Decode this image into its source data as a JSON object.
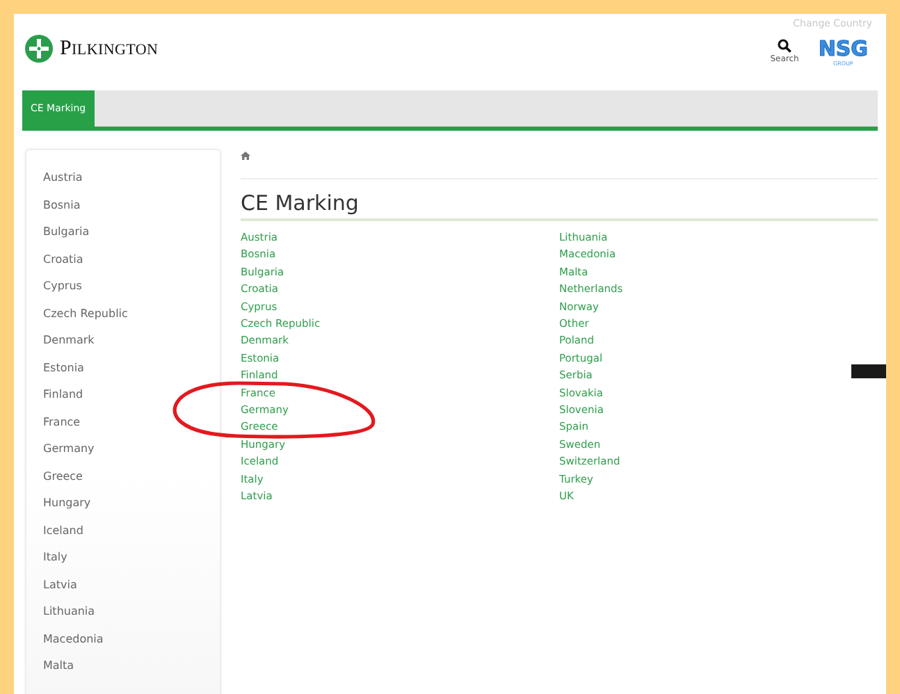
{
  "header": {
    "change_country": "Change Country",
    "logo_text": "Pilkington",
    "search_label": "Search",
    "group_logo": "NSG",
    "group_sub": "GROUP"
  },
  "nav_tabs": [
    {
      "label": "CE Marking",
      "selected": true
    }
  ],
  "sidebar": {
    "items": [
      "Austria",
      "Bosnia",
      "Bulgaria",
      "Croatia",
      "Cyprus",
      "Czech Republic",
      "Denmark",
      "Estonia",
      "Finland",
      "France",
      "Germany",
      "Greece",
      "Hungary",
      "Iceland",
      "Italy",
      "Latvia",
      "Lithuania",
      "Macedonia",
      "Malta"
    ]
  },
  "heading": "CE Marking",
  "countries": [
    [
      "Austria",
      "Bosnia",
      "Bulgaria",
      "Croatia",
      "Cyprus",
      "Czech Republic",
      "Denmark",
      "Estonia",
      "Finland",
      "France",
      "Germany",
      "Greece",
      "Hungary",
      "Iceland",
      "Italy",
      "Latvia"
    ],
    [
      "Lithuania",
      "Macedonia",
      "Malta",
      "Netherlands",
      "Norway",
      "Other",
      "Poland",
      "Portugal",
      "Serbia",
      "Slovakia",
      "Slovenia",
      "Spain",
      "Sweden",
      "Switzerland",
      "Turkey",
      "UK"
    ]
  ]
}
